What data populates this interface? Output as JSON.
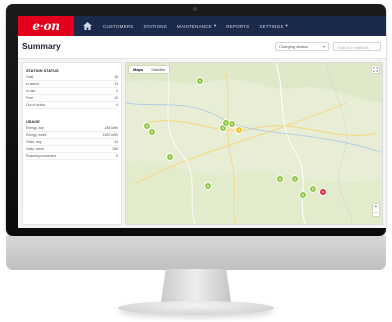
{
  "app": {
    "logo_text": "e·on",
    "nav": [
      {
        "label": "CUSTOMERS",
        "has_menu": false
      },
      {
        "label": "STATIONS",
        "has_menu": false
      },
      {
        "label": "MAINTENANCE",
        "has_menu": true
      },
      {
        "label": "REPORTS",
        "has_menu": false
      },
      {
        "label": "SETTINGS",
        "has_menu": true
      }
    ]
  },
  "page": {
    "title": "Summary",
    "select_value": "Charging station",
    "search_placeholder": "Search in stations"
  },
  "station_status": {
    "title": "STATION STATUS",
    "rows": [
      {
        "label": "Total",
        "value": "18"
      },
      {
        "label": "In action",
        "value": "13"
      },
      {
        "label": "In use",
        "value": "3"
      },
      {
        "label": "Free",
        "value": "10"
      },
      {
        "label": "Out of action",
        "value": "4"
      }
    ]
  },
  "usage": {
    "title": "USAGE",
    "rows": [
      {
        "label": "Energy, day",
        "value": "248 kWh"
      },
      {
        "label": "Energy, week",
        "value": "1620 kWh"
      },
      {
        "label": "Visits, day",
        "value": "44"
      },
      {
        "label": "Visits, week",
        "value": "286"
      },
      {
        "label": "Roaming customers",
        "value": "9"
      }
    ]
  },
  "map": {
    "tabs": [
      "Maps",
      "Satellite"
    ],
    "colors": {
      "green": "#8dc63f",
      "yellow": "#f2c21b",
      "red": "#e4223c"
    },
    "markers": [
      {
        "status": "green",
        "count": ""
      },
      {
        "status": "green",
        "count": ""
      },
      {
        "status": "green",
        "count": ""
      },
      {
        "status": "yellow",
        "count": ""
      },
      {
        "status": "green",
        "count": ""
      },
      {
        "status": "green",
        "count": ""
      },
      {
        "status": "green",
        "count": ""
      },
      {
        "status": "green",
        "count": ""
      },
      {
        "status": "green",
        "count": ""
      },
      {
        "status": "green",
        "count": ""
      },
      {
        "status": "green",
        "count": ""
      },
      {
        "status": "green",
        "count": ""
      },
      {
        "status": "green",
        "count": ""
      },
      {
        "status": "red",
        "count": ""
      }
    ]
  }
}
